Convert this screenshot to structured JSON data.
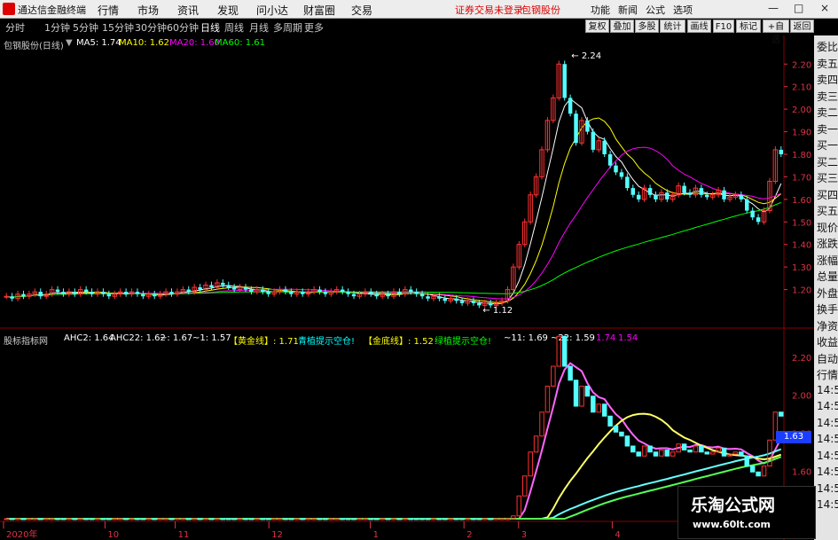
{
  "app_title": "通达信金融终端",
  "menus": [
    "行情",
    "市场",
    "资讯",
    "发现",
    "问小达",
    "财富圈",
    "交易"
  ],
  "warning": "证券交易未登录",
  "stock_name": "包钢股份",
  "right_menus": [
    "功能",
    "新闻",
    "公式",
    "选项"
  ],
  "window_controls": [
    "—",
    "□",
    "×"
  ],
  "periods": [
    "分时",
    "1分钟",
    "5分钟",
    "15分钟",
    "30分钟",
    "60分钟",
    "日线",
    "周线",
    "月线",
    "多周期",
    "更多"
  ],
  "active_period": "日线",
  "tools": [
    "复权",
    "叠加",
    "多股",
    "统计",
    "画线",
    "F10",
    "标记",
    "+自选",
    "返回"
  ],
  "main_panel": {
    "title": "包钢股份(日线)",
    "ma5": "MA5: 1.74",
    "ma10": "MA10: 1.62",
    "ma20": "MA20: 1.60",
    "ma60": "MA60: 1.61",
    "high_label": "2.24",
    "low_label": "1.12",
    "axis": [
      "2.20",
      "2.10",
      "2.00",
      "1.90",
      "1.80",
      "1.70",
      "1.60",
      "1.50",
      "1.40",
      "1.30",
      "1.20"
    ]
  },
  "sub_panel": {
    "title": "股标指标网",
    "ahc2": "AHC2: 1.64",
    "ahc22": "AHC22: 1.62",
    "v1": "~: 1.67",
    "v2": "~1: 1.57",
    "gold_line": "【黄金线】: 1.71",
    "green_hint": "青植提示空仓!",
    "golden_base": "【金底线】: 1.52",
    "green_hint2": "绿植提示空仓!",
    "v3": "~11: 1.69",
    "v4": "~22: 1.59",
    "v5": "1.74",
    "v6": "1.54",
    "axis": [
      "2.20",
      "2.00",
      "1.80",
      "1.60",
      "1.40"
    ],
    "current": "1.63"
  },
  "x_labels": [
    "2020年",
    "10",
    "11",
    "12",
    "1",
    "2",
    "3",
    "4"
  ],
  "right_panel": [
    "委比",
    "卖五",
    "卖四",
    "卖三",
    "卖二",
    "卖一",
    "买一",
    "买二",
    "买三",
    "买四",
    "买五",
    "现价",
    "涨跌",
    "涨幅",
    "总量",
    "外盘",
    "换手",
    "净资",
    "收益",
    "自动",
    "行情",
    "14:50",
    "14:50",
    "14:50",
    "14:50",
    "14:50",
    "14:50",
    "14:50",
    "14:50"
  ],
  "watermark": "乐淘公式网",
  "watermark_url": "www.60lt.com",
  "colors": {
    "up": "#ff3232",
    "down": "#54ffff",
    "ma5": "#ffffff",
    "ma10": "#ffff00",
    "ma20": "#ff00ff",
    "ma60": "#00ff00"
  },
  "chart_data": {
    "type": "candlestick",
    "title": "包钢股份(日线)",
    "xlabel": "",
    "ylabel": "",
    "ylim": [
      1.1,
      2.26
    ],
    "x_ticks": [
      "2020年",
      "10",
      "11",
      "12",
      "1",
      "2",
      "3",
      "4"
    ],
    "close": [
      1.17,
      1.16,
      1.18,
      1.17,
      1.18,
      1.19,
      1.17,
      1.18,
      1.2,
      1.19,
      1.18,
      1.19,
      1.18,
      1.2,
      1.19,
      1.18,
      1.19,
      1.18,
      1.17,
      1.18,
      1.19,
      1.18,
      1.19,
      1.18,
      1.17,
      1.18,
      1.17,
      1.18,
      1.19,
      1.18,
      1.19,
      1.2,
      1.19,
      1.21,
      1.2,
      1.22,
      1.21,
      1.23,
      1.22,
      1.21,
      1.2,
      1.21,
      1.2,
      1.19,
      1.2,
      1.19,
      1.18,
      1.19,
      1.2,
      1.19,
      1.18,
      1.19,
      1.18,
      1.19,
      1.2,
      1.19,
      1.18,
      1.19,
      1.2,
      1.19,
      1.18,
      1.17,
      1.18,
      1.19,
      1.18,
      1.17,
      1.18,
      1.17,
      1.19,
      1.18,
      1.2,
      1.19,
      1.18,
      1.17,
      1.16,
      1.17,
      1.16,
      1.15,
      1.16,
      1.15,
      1.14,
      1.15,
      1.14,
      1.13,
      1.14,
      1.13,
      1.14,
      1.15,
      1.2,
      1.3,
      1.4,
      1.5,
      1.62,
      1.7,
      1.82,
      1.95,
      2.05,
      2.2,
      2.05,
      1.98,
      1.85,
      1.95,
      1.9,
      1.82,
      1.86,
      1.8,
      1.75,
      1.72,
      1.7,
      1.65,
      1.62,
      1.6,
      1.65,
      1.62,
      1.6,
      1.63,
      1.6,
      1.62,
      1.66,
      1.63,
      1.62,
      1.65,
      1.62,
      1.61,
      1.62,
      1.64,
      1.6,
      1.61,
      1.62,
      1.6,
      1.55,
      1.52,
      1.5,
      1.55,
      1.68,
      1.82,
      1.8
    ],
    "high_marker": 2.24,
    "low_marker": 1.12
  }
}
